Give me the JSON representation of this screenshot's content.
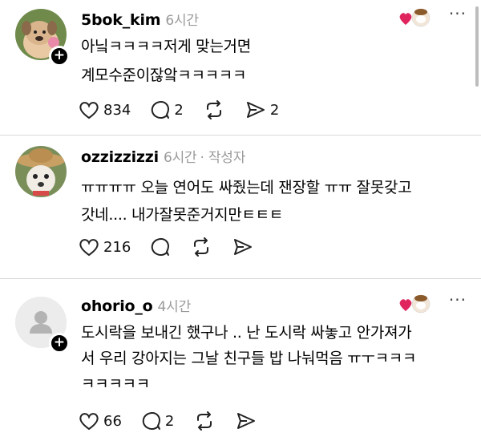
{
  "posts": [
    {
      "username": "5bok_kim",
      "time": "6시간",
      "line1": "아닠ㅋㅋㅋㅋ저게 맞는거면",
      "line2": "계모수준이잖앜ㅋㅋㅋㅋㅋ",
      "likes": "834",
      "comments": "2",
      "shares": "2"
    },
    {
      "username": "ozzizzizzi",
      "time": "6시간",
      "author_tag": "· 작성자",
      "line1": "ㅠㅠㅠㅠ 오늘 연어도 싸줬는데 잰장할 ㅠㅠ 잘못갖고",
      "line2": "갓네.... 내가잘못준거지만ㅌㅌㅌ",
      "likes": "216"
    },
    {
      "username": "ohorio_o",
      "time": "4시간",
      "line1": "도시락을 보내긴 했구나 .. 난 도시락 싸놓고 안가져가",
      "line2": "서 우리 강아지는 그날 친구들 밥 나눠먹음 ㅠㅜㅋㅋㅋ",
      "line3": "ㅋㅋㅋㅋㅋ",
      "likes": "66",
      "comments": "2"
    }
  ],
  "icons": {
    "like": "heart-outline-icon",
    "comment": "speech-bubble-icon",
    "repost": "repost-arrows-icon",
    "share": "send-arrow-icon",
    "liked_by_author": "red-heart-icon",
    "more": "more-dots-icon",
    "follow": "plus-icon"
  },
  "colors": {
    "accent_red": "#e0245e",
    "meta_gray": "#9a9a9a",
    "divider": "#d9d9d9"
  }
}
